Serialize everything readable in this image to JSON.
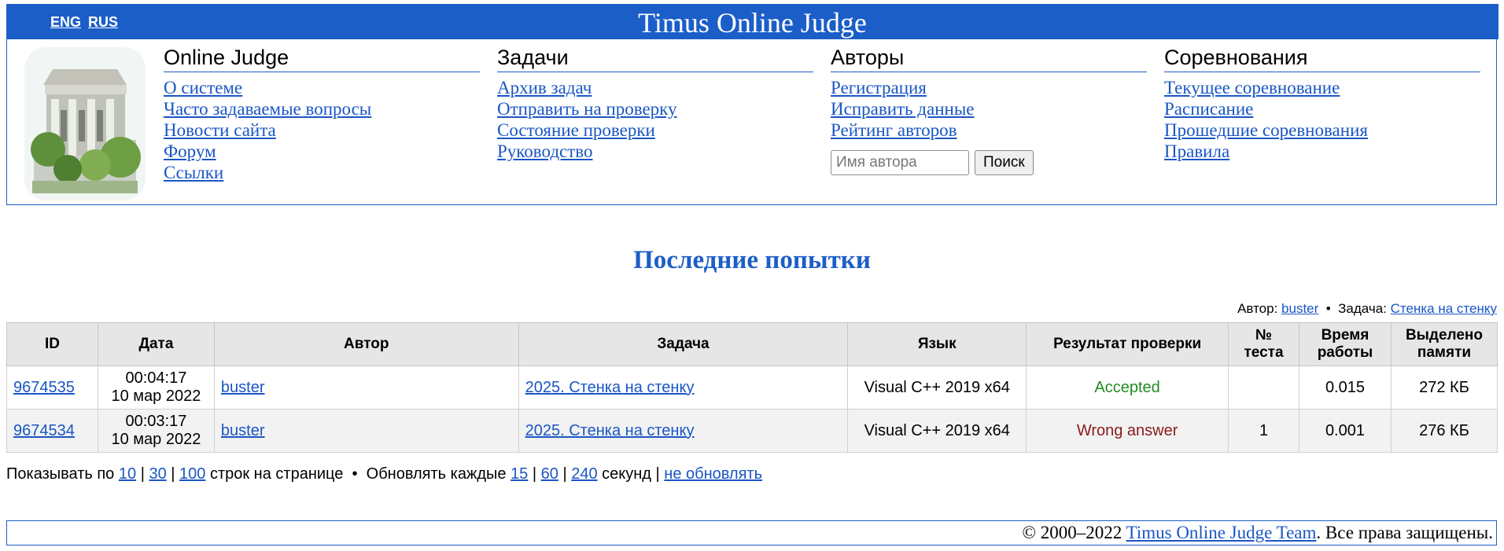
{
  "header": {
    "lang_eng": "ENG",
    "lang_rus": "RUS",
    "site_title": "Timus Online Judge"
  },
  "menu": {
    "columns": [
      {
        "heading": "Online Judge",
        "links": [
          "О системе",
          "Часто задаваемые вопросы",
          "Новости сайта",
          "Форум",
          "Ссылки"
        ]
      },
      {
        "heading": "Задачи",
        "links": [
          "Архив задач",
          "Отправить на проверку",
          "Состояние проверки",
          "Руководство"
        ]
      },
      {
        "heading": "Авторы",
        "links": [
          "Регистрация",
          "Исправить данные",
          "Рейтинг авторов"
        ]
      },
      {
        "heading": "Соревнования",
        "links": [
          "Текущее соревнование",
          "Расписание",
          "Прошедшие соревнования",
          "Правила"
        ]
      }
    ],
    "search": {
      "placeholder": "Имя автора",
      "button": "Поиск"
    }
  },
  "page_heading": "Последние попытки",
  "filter": {
    "author_label": "Автор:",
    "author": "buster",
    "separator": "•",
    "problem_label": "Задача:",
    "problem": "Стенка на стенку"
  },
  "table": {
    "headers": {
      "id": "ID",
      "date": "Дата",
      "author": "Автор",
      "problem": "Задача",
      "language": "Язык",
      "result": "Результат проверки",
      "test_line1": "№",
      "test_line2": "теста",
      "time_line1": "Время",
      "time_line2": "работы",
      "memory_line1": "Выделено",
      "memory_line2": "памяти"
    },
    "rows": [
      {
        "id": "9674535",
        "time": "00:04:17",
        "date": "10 мар 2022",
        "author": "buster",
        "problem": "2025. Стенка на стенку",
        "language": "Visual C++ 2019 x64",
        "result": "Accepted",
        "test": "",
        "runtime": "0.015",
        "memory": "272 КБ"
      },
      {
        "id": "9674534",
        "time": "00:03:17",
        "date": "10 мар 2022",
        "author": "buster",
        "problem": "2025. Стенка на стенку",
        "language": "Visual C++ 2019 x64",
        "result": "Wrong answer",
        "test": "1",
        "runtime": "0.001",
        "memory": "276 КБ"
      }
    ]
  },
  "pager": {
    "show_label": "Показывать по",
    "show_options": [
      "10",
      "30",
      "100"
    ],
    "rows_label": "строк на странице",
    "bullet": "•",
    "refresh_label": "Обновлять каждые",
    "refresh_options": [
      "15",
      "60",
      "240"
    ],
    "seconds_label": "секунд",
    "no_refresh": "не обновлять",
    "sep": "|"
  },
  "footer": {
    "copyright": "© 2000–2022",
    "team_link": "Timus Online Judge Team",
    "rights": ". Все права защищены."
  },
  "colors": {
    "accent": "#1c5ec8",
    "link": "#1a56c4",
    "accepted": "#228b22",
    "wrong": "#8b1a1a"
  }
}
